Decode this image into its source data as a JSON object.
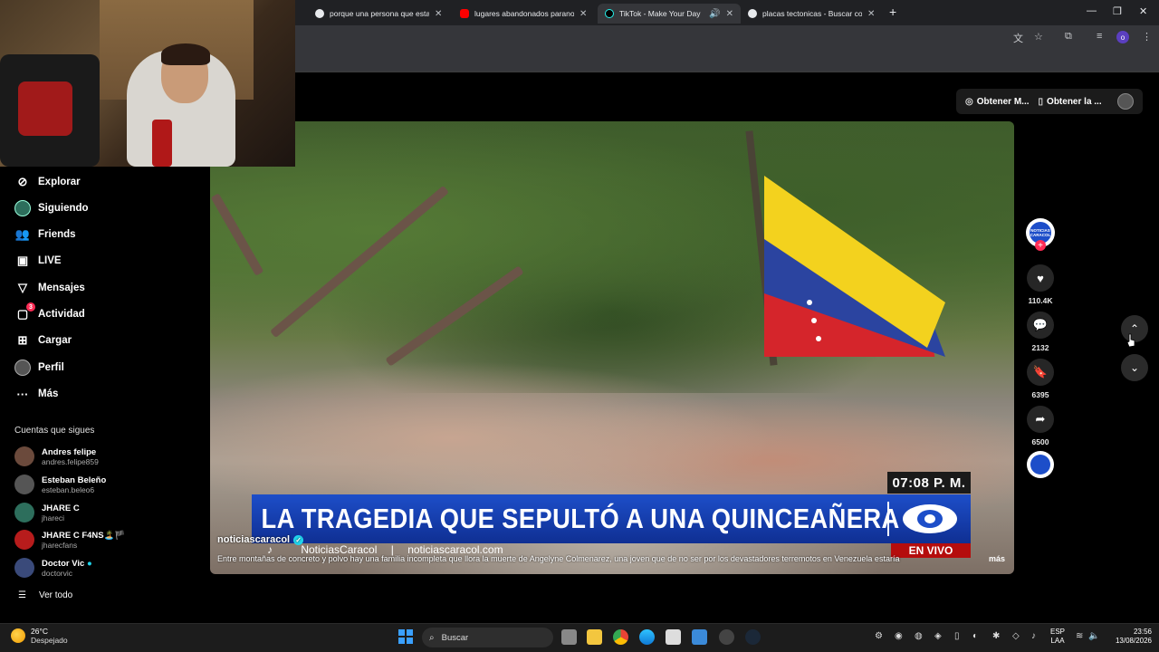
{
  "browser": {
    "tabs": [
      {
        "title": "porque una persona que estab",
        "favicon_color": "#e8eaed",
        "active": false
      },
      {
        "title": "lugares abandonados paranorm",
        "favicon_color": "#ff0000",
        "active": false
      },
      {
        "title": "TikTok - Make Your Day",
        "favicon_color": "#000000",
        "active": true
      },
      {
        "title": "placas tectonicas - Buscar con",
        "favicon_color": "#e8eaed",
        "active": false
      }
    ],
    "new_tab": "+",
    "profile_initial": "o"
  },
  "topbar": {
    "btn1": "Obtener M...",
    "btn2": "Obtener la ..."
  },
  "sidebar": {
    "nav": [
      {
        "label": "Explorar",
        "icon": "compass-icon"
      },
      {
        "label": "Siguiendo",
        "icon": "avatar-icon"
      },
      {
        "label": "Friends",
        "icon": "users-icon"
      },
      {
        "label": "LIVE",
        "icon": "live-icon"
      },
      {
        "label": "Mensajes",
        "icon": "send-icon"
      },
      {
        "label": "Actividad",
        "icon": "bubble-icon",
        "badge": "3"
      },
      {
        "label": "Cargar",
        "icon": "plus-square-icon"
      },
      {
        "label": "Perfil",
        "icon": "profile-icon"
      },
      {
        "label": "Más",
        "icon": "ellipsis-icon"
      }
    ],
    "following_title": "Cuentas que sigues",
    "following": [
      {
        "name": "Andres felipe",
        "handle": "andres.felipe859",
        "color": "#6b4a3c"
      },
      {
        "name": "Esteban Beleño",
        "handle": "esteban.beleo6",
        "color": "#555555"
      },
      {
        "name": "JHARE C",
        "handle": "jhareci",
        "color": "#2d6e5c"
      },
      {
        "name": "JHARE C F4NS🏝️🏴",
        "handle": "jharecfans",
        "color": "#b71c1c"
      },
      {
        "name": "Doctor Vic",
        "handle": "doctorvic",
        "color": "#3a4a7a",
        "verified": true
      }
    ],
    "see_all": "Ver todo"
  },
  "video": {
    "time_overlay": "07:08 P. M.",
    "headline": "LA TRAGEDIA QUE SEPULTÓ A UNA QUINCEAÑERA",
    "brand_name": "NoticiasCaracol",
    "brand_url": "noticiascaracol.com",
    "live_label": "EN VIVO",
    "author": "noticiascaracol",
    "caption": "Entre montañas de concreto y polvo hay una familia incompleta que llora la muerte de Angelyne Colmenarez, una joven que de no ser por los devastadores terremotos en Venezuela estaría",
    "more": "más",
    "logo_text": "NOTICIAS CARACOL"
  },
  "actions": {
    "likes": "110.4K",
    "comments": "2132",
    "saves": "6395",
    "shares": "6500"
  },
  "taskbar": {
    "temp": "26°C",
    "weather": "Despejado",
    "search": "Buscar",
    "lang1": "ESP",
    "lang2": "LAA",
    "time": "23:56",
    "date": "13/08/2026"
  }
}
